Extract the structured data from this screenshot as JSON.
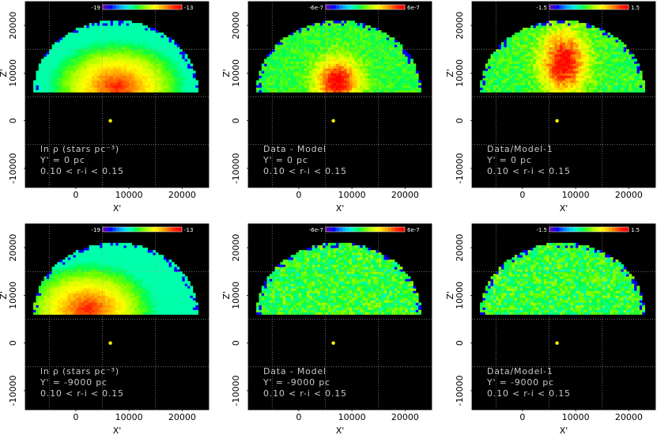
{
  "chart_data": [
    {
      "type": "heatmap",
      "panel": "top-left",
      "colorbar": {
        "min_label": "-19",
        "max_label": "-13",
        "min": -19,
        "max": -13
      },
      "annotation_lines": [
        "ln ρ (stars pc⁻³)",
        "Y' = 0 pc",
        "0.10 < r-i < 0.15"
      ],
      "xlabel": "X'",
      "ylabel": "Z'",
      "xticks": [
        "0",
        "10000",
        "20000"
      ],
      "yticks": [
        "-10000",
        "0",
        "10000",
        "20000"
      ],
      "xlim": [
        -9500,
        25000
      ],
      "ylim": [
        -14000,
        25000
      ],
      "marker": {
        "x": 6500,
        "y": 0,
        "color": "#ffff00"
      },
      "grid": true,
      "pattern": "density-bottom-center",
      "hot_spot": {
        "x": 7500,
        "y": 7000
      }
    },
    {
      "type": "heatmap",
      "panel": "top-middle",
      "colorbar": {
        "min_label": "-6e-7",
        "max_label": "6e-7",
        "min": -6e-07,
        "max": 6e-07
      },
      "annotation_lines": [
        "Data - Model",
        "Y' = 0 pc",
        "0.10 < r-i < 0.15"
      ],
      "xlabel": "X'",
      "ylabel": "Z'",
      "xticks": [
        "0",
        "10000",
        "20000"
      ],
      "yticks": [
        "-10000",
        "0",
        "10000",
        "20000"
      ],
      "xlim": [
        -9500,
        25000
      ],
      "ylim": [
        -14000,
        25000
      ],
      "marker": {
        "x": 6500,
        "y": 0,
        "color": "#ffff00"
      },
      "grid": true,
      "pattern": "residual-blob",
      "hot_spot": {
        "x": 7000,
        "y": 8000
      }
    },
    {
      "type": "heatmap",
      "panel": "top-right",
      "colorbar": {
        "min_label": "-1.5",
        "max_label": "1.5",
        "min": -1.5,
        "max": 1.5
      },
      "annotation_lines": [
        "Data/Model-1",
        "Y' = 0 pc",
        "0.10 < r-i < 0.15"
      ],
      "xlabel": "X'",
      "ylabel": "Z'",
      "xticks": [
        "0",
        "10000",
        "20000"
      ],
      "yticks": [
        "-10000",
        "0",
        "10000",
        "20000"
      ],
      "xlim": [
        -9500,
        25000
      ],
      "ylim": [
        -14000,
        25000
      ],
      "marker": {
        "x": 6500,
        "y": 0,
        "color": "#ffff00"
      },
      "grid": true,
      "pattern": "ratio-column",
      "hot_spot": {
        "x": 7500,
        "y": 12000
      }
    },
    {
      "type": "heatmap",
      "panel": "bottom-left",
      "colorbar": {
        "min_label": "-19",
        "max_label": "-13",
        "min": -19,
        "max": -13
      },
      "annotation_lines": [
        "ln ρ (stars pc⁻³)",
        "Y' = -9000 pc",
        "0.10 < r-i < 0.15"
      ],
      "xlabel": "X'",
      "ylabel": "Z'",
      "xticks": [
        "0",
        "10000",
        "20000"
      ],
      "yticks": [
        "-10000",
        "0",
        "10000",
        "20000"
      ],
      "xlim": [
        -9500,
        25000
      ],
      "ylim": [
        -14000,
        25000
      ],
      "marker": {
        "x": 6500,
        "y": 0,
        "color": "#ffff00"
      },
      "grid": true,
      "pattern": "density-bottom-center",
      "hot_spot": {
        "x": 2000,
        "y": 7000
      }
    },
    {
      "type": "heatmap",
      "panel": "bottom-middle",
      "colorbar": {
        "min_label": "-6e-7",
        "max_label": "6e-7",
        "min": -6e-07,
        "max": 6e-07
      },
      "annotation_lines": [
        "Data - Model",
        "Y' = -9000 pc",
        "0.10 < r-i < 0.15"
      ],
      "xlabel": "X'",
      "ylabel": "Z'",
      "xticks": [
        "0",
        "10000",
        "20000"
      ],
      "yticks": [
        "-10000",
        "0",
        "10000",
        "20000"
      ],
      "xlim": [
        -9500,
        25000
      ],
      "ylim": [
        -14000,
        25000
      ],
      "marker": {
        "x": 6500,
        "y": 0,
        "color": "#ffff00"
      },
      "grid": true,
      "pattern": "flat-noise"
    },
    {
      "type": "heatmap",
      "panel": "bottom-right",
      "colorbar": {
        "min_label": "-1.5",
        "max_label": "1.5",
        "min": -1.5,
        "max": 1.5
      },
      "annotation_lines": [
        "Data/Model-1",
        "Y' = -9000 pc",
        "0.10 < r-i < 0.15"
      ],
      "xlabel": "X'",
      "ylabel": "Z'",
      "xticks": [
        "0",
        "10000",
        "20000"
      ],
      "yticks": [
        "-10000",
        "0",
        "10000",
        "20000"
      ],
      "xlim": [
        -9500,
        25000
      ],
      "ylim": [
        -14000,
        25000
      ],
      "marker": {
        "x": 6500,
        "y": 0,
        "color": "#ffff00"
      },
      "grid": true,
      "pattern": "flat-noise"
    }
  ],
  "colormap": [
    "#000000",
    "#5a00b4",
    "#0000ff",
    "#0078ff",
    "#00c8ff",
    "#00ffc0",
    "#00ff50",
    "#64ff00",
    "#c8ff00",
    "#ffff00",
    "#ffc000",
    "#ff7800",
    "#ff2800",
    "#ff0000"
  ],
  "colors": {
    "panel_background": "#000000",
    "page_background": "#ffffff",
    "annotation_text": "#c8c8c8",
    "grid": "#9a9a9a",
    "axis_text": "#000000"
  }
}
